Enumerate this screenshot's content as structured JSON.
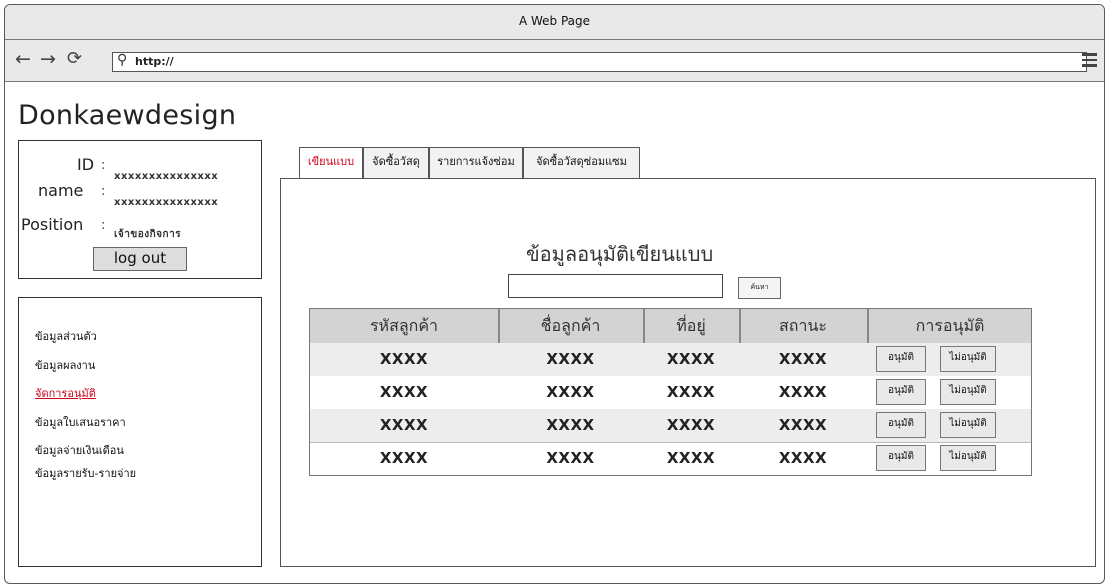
{
  "window": {
    "title": "A Web Page"
  },
  "browser": {
    "url": "http://"
  },
  "brand": "Donkaewdesign",
  "user": {
    "id_label": "ID",
    "id_value": "xxxxxxxxxxxxxxx",
    "name_label": "name",
    "name_value": "xxxxxxxxxxxxxxx",
    "position_label": "Position",
    "position_value": "เจ้าของกิจการ",
    "colon": ":",
    "logout_label": "log out"
  },
  "sidebar": {
    "items": [
      {
        "label": "ข้อมูลส่วนตัว",
        "active": false
      },
      {
        "label": "ข้อมูลผลงาน",
        "active": false
      },
      {
        "label": "จัดการอนุมัติ",
        "active": true
      },
      {
        "label": "ข้อมูลใบเสนอราคา",
        "active": false
      },
      {
        "label": "ข้อมูลจ่ายเงินเดือน",
        "active": false
      },
      {
        "label": "ข้อมูลรายรับ-รายจ่าย",
        "active": false
      }
    ]
  },
  "tabs": [
    {
      "label": "เขียนแบบ",
      "active": true
    },
    {
      "label": "จัดซื้อวัสดุ",
      "active": false
    },
    {
      "label": "รายการแจ้งซ่อม",
      "active": false
    },
    {
      "label": "จัดซื้อวัสดุซ่อมแซม",
      "active": false
    }
  ],
  "main": {
    "heading": "ข้อมูลอนุมัติเขียนแบบ",
    "search_button": "ค้นหา",
    "search_value": ""
  },
  "table": {
    "headers": [
      "รหัสลูกค้า",
      "ชื่อลูกค้า",
      "ที่อยู่",
      "สถานะ",
      "การอนุมัติ"
    ],
    "rows": [
      [
        "XXXX",
        "XXXX",
        "XXXX",
        "XXXX"
      ],
      [
        "XXXX",
        "XXXX",
        "XXXX",
        "XXXX"
      ],
      [
        "XXXX",
        "XXXX",
        "XXXX",
        "XXXX"
      ],
      [
        "XXXX",
        "XXXX",
        "XXXX",
        "XXXX"
      ]
    ],
    "approve_label": "อนุมัติ",
    "reject_label": "ไม่อนุมัติ"
  },
  "colors": {
    "accent_red": "#d0021b",
    "header_gray": "#d3d3d3",
    "stripe_gray": "#ededed"
  }
}
